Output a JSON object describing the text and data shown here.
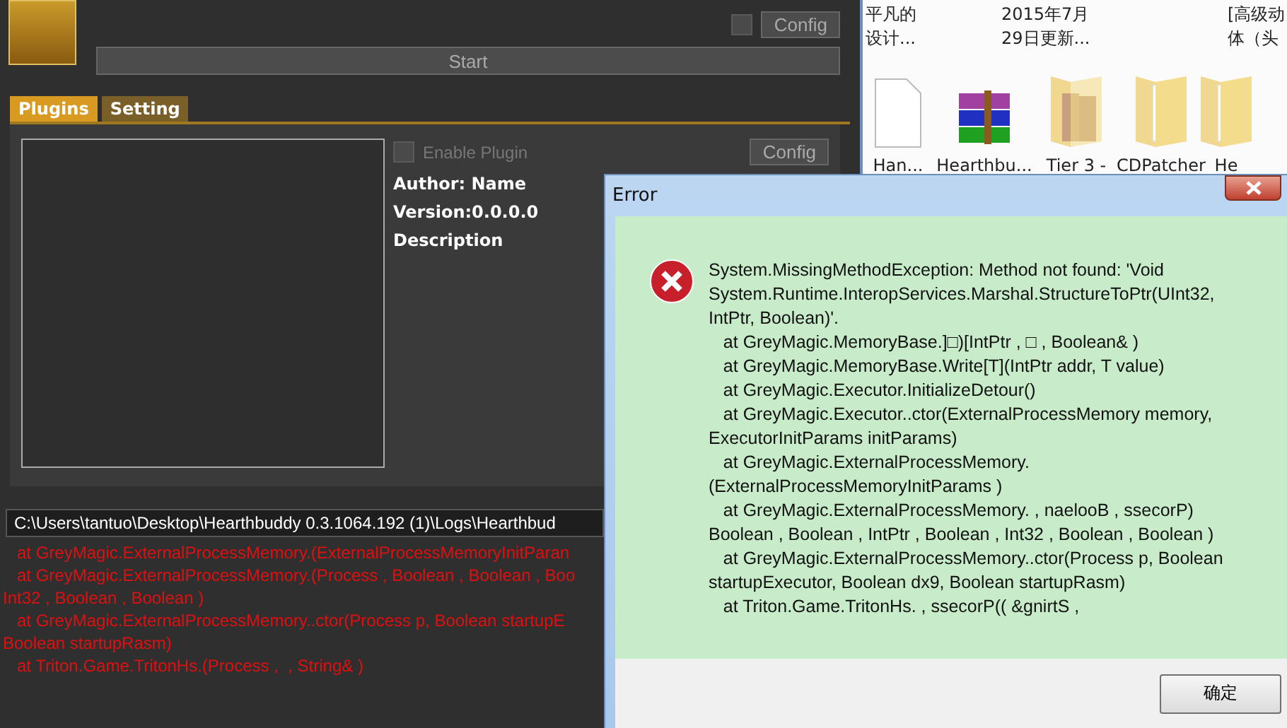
{
  "app": {
    "top_checkbox": {
      "checked": false
    },
    "config_label": "Config",
    "start_label": "Start",
    "tabs": [
      {
        "label": "Plugins",
        "selected": true
      },
      {
        "label": "Setting",
        "selected": false
      }
    ],
    "plugin": {
      "enable_label": "Enable Plugin",
      "enabled": false,
      "disabled": true,
      "config_label": "Config",
      "author": "Author: Name",
      "version": "Version:0.0.0.0",
      "description": "Description"
    },
    "log": {
      "path": "C:\\Users\\tantuo\\Desktop\\Hearthbuddy 0.3.1064.192 (1)\\Logs\\Hearthbud",
      "lines": [
        {
          "text": "at GreyMagic.ExternalProcessMemory.(ExternalProcessMemoryInitParan",
          "indent": true
        },
        {
          "text": "at GreyMagic.ExternalProcessMemory.(Process , Boolean , Boolean , Boo",
          "indent": true
        },
        {
          "text": "Int32 , Boolean , Boolean )",
          "indent": false
        },
        {
          "text": "at GreyMagic.ExternalProcessMemory..ctor(Process p, Boolean startupE",
          "indent": true
        },
        {
          "text": "Boolean startupRasm)",
          "indent": false
        },
        {
          "text": "at Triton.Game.TritonHs.(Process ,  , String& )",
          "indent": true
        }
      ]
    }
  },
  "desktop": {
    "top_labels": [
      {
        "lines": [
          "平凡的",
          "设计..."
        ]
      },
      {
        "lines": [
          "2015年7月",
          "29日更新..."
        ]
      },
      {
        "lines": [
          "[高级动",
          "体（头"
        ]
      }
    ],
    "icons": [
      {
        "label": "Han...",
        "kind": "file"
      },
      {
        "label": "Hearthbu...",
        "kind": "archive"
      },
      {
        "label": "Tier 3 -",
        "kind": "photo-folder"
      },
      {
        "label": "CDPatcher",
        "kind": "folder"
      },
      {
        "label": "He",
        "kind": "folder"
      }
    ]
  },
  "dialog": {
    "title": "Error",
    "message": "System.MissingMethodException: Method not found: 'Void\nSystem.Runtime.InteropServices.Marshal.StructureToPtr(UInt32,\nIntPtr, Boolean)'.\n   at GreyMagic.MemoryBase.]□)[IntPtr , □ , Boolean& )\n   at GreyMagic.MemoryBase.Write[T](IntPtr addr, T value)\n   at GreyMagic.Executor.InitializeDetour()\n   at GreyMagic.Executor..ctor(ExternalProcessMemory memory,\nExecutorInitParams initParams)\n   at GreyMagic.ExternalProcessMemory.\n(ExternalProcessMemoryInitParams )\n   at GreyMagic.ExternalProcessMemory. , naelooB , ssecorP)\nBoolean , Boolean , IntPtr , Boolean , Int32 , Boolean , Boolean )\n   at GreyMagic.ExternalProcessMemory..ctor(Process p, Boolean\nstartupExecutor, Boolean dx9, Boolean startupRasm)\n   at Triton.Game.TritonHs. , ssecorP(( &gnirtS ,",
    "button": "确定"
  }
}
